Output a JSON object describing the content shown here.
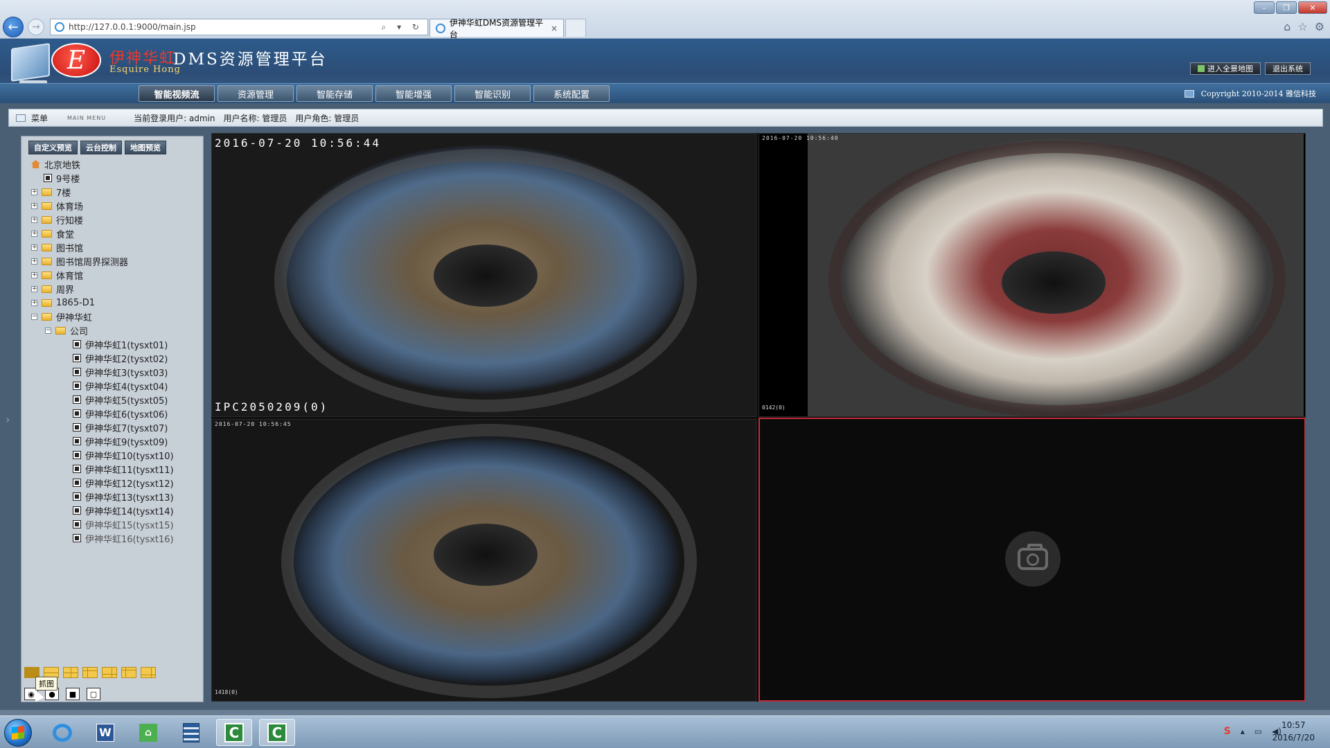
{
  "browser": {
    "url": "http://127.0.0.1:9000/main.jsp",
    "tab_title": "伊神华虹DMS资源管理平台",
    "tab_close": "×",
    "address_tools": "⌕ ▾ ↻",
    "back_glyph": "←",
    "forward_glyph": "→",
    "win_minimize": "–",
    "win_restore": "❐",
    "win_close": "✕",
    "right_icons": [
      "home-icon",
      "star-icon",
      "gear-icon"
    ]
  },
  "header": {
    "logo_letter": "E",
    "brand_cn": "伊神华虹",
    "brand_en": "Esquire Hong",
    "platform_title": "DMS资源管理平台",
    "actions": [
      "进入全景地图",
      "退出系统"
    ],
    "copyright": "Copyright 2010-2014 雅信科技"
  },
  "nav": {
    "tabs": [
      "智能视频流",
      "资源管理",
      "智能存储",
      "智能增强",
      "智能识别",
      "系统配置"
    ],
    "active_index": 0
  },
  "info_bar": {
    "menu_label": "菜单",
    "main_menu_tag": "MAIN MENU",
    "login_user": "当前登录用户: admin",
    "user_name": "用户名称: 管理员",
    "user_role": "用户角色: 管理员"
  },
  "left_panel": {
    "sub_tabs": [
      "自定义预览",
      "云台控制",
      "地图预览"
    ],
    "tree": [
      {
        "label": "北京地铁",
        "type": "root"
      },
      {
        "label": "9号楼",
        "type": "camera-node"
      },
      {
        "label": "7楼",
        "type": "folder"
      },
      {
        "label": "体育场",
        "type": "folder"
      },
      {
        "label": "行知楼",
        "type": "folder"
      },
      {
        "label": "食堂",
        "type": "folder"
      },
      {
        "label": "图书馆",
        "type": "folder"
      },
      {
        "label": "图书馆周界探测器",
        "type": "folder"
      },
      {
        "label": "体育馆",
        "type": "folder"
      },
      {
        "label": "周界",
        "type": "folder"
      },
      {
        "label": "1865-D1",
        "type": "folder"
      },
      {
        "label": "伊神华虹",
        "type": "folder-open"
      },
      {
        "label": "公司",
        "type": "subfolder-open"
      },
      {
        "label": "伊神华虹1(tysxt01)",
        "type": "camera"
      },
      {
        "label": "伊神华虹2(tysxt02)",
        "type": "camera"
      },
      {
        "label": "伊神华虹3(tysxt03)",
        "type": "camera"
      },
      {
        "label": "伊神华虹4(tysxt04)",
        "type": "camera"
      },
      {
        "label": "伊神华虹5(tysxt05)",
        "type": "camera"
      },
      {
        "label": "伊神华虹6(tysxt06)",
        "type": "camera"
      },
      {
        "label": "伊神华虹7(tysxt07)",
        "type": "camera"
      },
      {
        "label": "伊神华虹9(tysxt09)",
        "type": "camera"
      },
      {
        "label": "伊神华虹10(tysxt10)",
        "type": "camera"
      },
      {
        "label": "伊神华虹11(tysxt11)",
        "type": "camera"
      },
      {
        "label": "伊神华虹12(tysxt12)",
        "type": "camera"
      },
      {
        "label": "伊神华虹13(tysxt13)",
        "type": "camera"
      },
      {
        "label": "伊神华虹14(tysxt14)",
        "type": "camera"
      },
      {
        "label": "伊神华虹15(tysxt15)",
        "type": "camera-dim"
      },
      {
        "label": "伊神华虹16(tysxt16)",
        "type": "camera-dim"
      }
    ],
    "tooltip": "抓图"
  },
  "video": {
    "cell1": {
      "timestamp": "2016-07-20 10:56:44",
      "camera": "IPC2050209(0)"
    },
    "cell2": {
      "timestamp": "2016-07-20 10:56:40",
      "camera": "0142(0)"
    },
    "cell3": {
      "timestamp": "2016-07-20 10:56:45",
      "camera": "1418(0)"
    },
    "cell4": {
      "icon": "camera-icon"
    }
  },
  "taskbar": {
    "word_glyph": "W",
    "sheets_glyph": "⌂",
    "c_glyph": "C",
    "tray_s": "S",
    "tray_up": "▴",
    "tray_net": "▭",
    "tray_vol": "◀)",
    "clock_time": "10:57",
    "clock_date": "2016/7/20"
  },
  "colors": {
    "header_blue": "#2c4d76",
    "accent_red": "#c22c38",
    "panel_gray": "#c7cfd7"
  }
}
